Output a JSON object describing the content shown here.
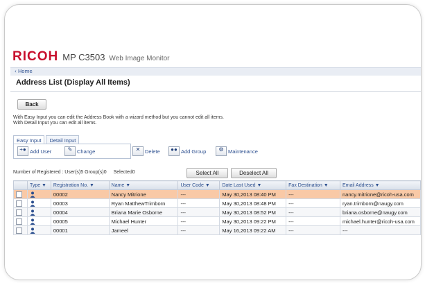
{
  "header": {
    "brand": "RICOH",
    "model": "MP C3503",
    "app_name": "Web Image Monitor",
    "brand_color": "#c8102e"
  },
  "breadcrumb": {
    "home": "‹ Home"
  },
  "page": {
    "title": "Address List (Display All Items)"
  },
  "back_button": {
    "label": "Back"
  },
  "description": {
    "line1": "With Easy Input you can edit the Address Book with a wizard method but you cannot edit all items.",
    "line2": "With Detail Input you can edit all items."
  },
  "tabs": [
    {
      "label": "Easy Input",
      "active": true
    },
    {
      "label": "Detail Input",
      "active": false
    }
  ],
  "toolbar": {
    "add_user": "Add User",
    "change": "Change",
    "delete": "Delete",
    "add_group": "Add Group",
    "maintenance": "Maintenance"
  },
  "counts": {
    "registered": "Number of Registered : User(s)5 Group(s)0",
    "selected": "Selected0"
  },
  "select_all": "Select All",
  "deselect_all": "Deselect All",
  "table": {
    "columns": [
      "Type ▼",
      "Registration No. ▼",
      "Name ▼",
      "User Code ▼",
      "Date Last Used ▼",
      "Fax Destination ▼",
      "Email Address ▼"
    ],
    "rows": [
      {
        "reg": "00002",
        "name": "Nancy Mitrione",
        "code": "---",
        "date": "May 30,2013 08:40 PM",
        "fax": "---",
        "email": "nancy.mitrione@ricoh-usa.com",
        "selected": true
      },
      {
        "reg": "00003",
        "name": "Ryan MatthewTrimborn",
        "code": "---",
        "date": "May 30,2013 08:48 PM",
        "fax": "---",
        "email": "ryan.trimborn@naugy.com",
        "selected": false
      },
      {
        "reg": "00004",
        "name": "Briana Marie Osborne",
        "code": "---",
        "date": "May 30,2013 08:52 PM",
        "fax": "---",
        "email": "briana.osborne@naugy.com",
        "selected": false
      },
      {
        "reg": "00005",
        "name": "Michael Hunter",
        "code": "---",
        "date": "May 30,2013 09:22 PM",
        "fax": "---",
        "email": "michael.hunter@ricoh-usa.com",
        "selected": false
      },
      {
        "reg": "00001",
        "name": "Jameel",
        "code": "---",
        "date": "May 16,2013 09:22 AM",
        "fax": "---",
        "email": "---",
        "selected": false
      }
    ]
  }
}
